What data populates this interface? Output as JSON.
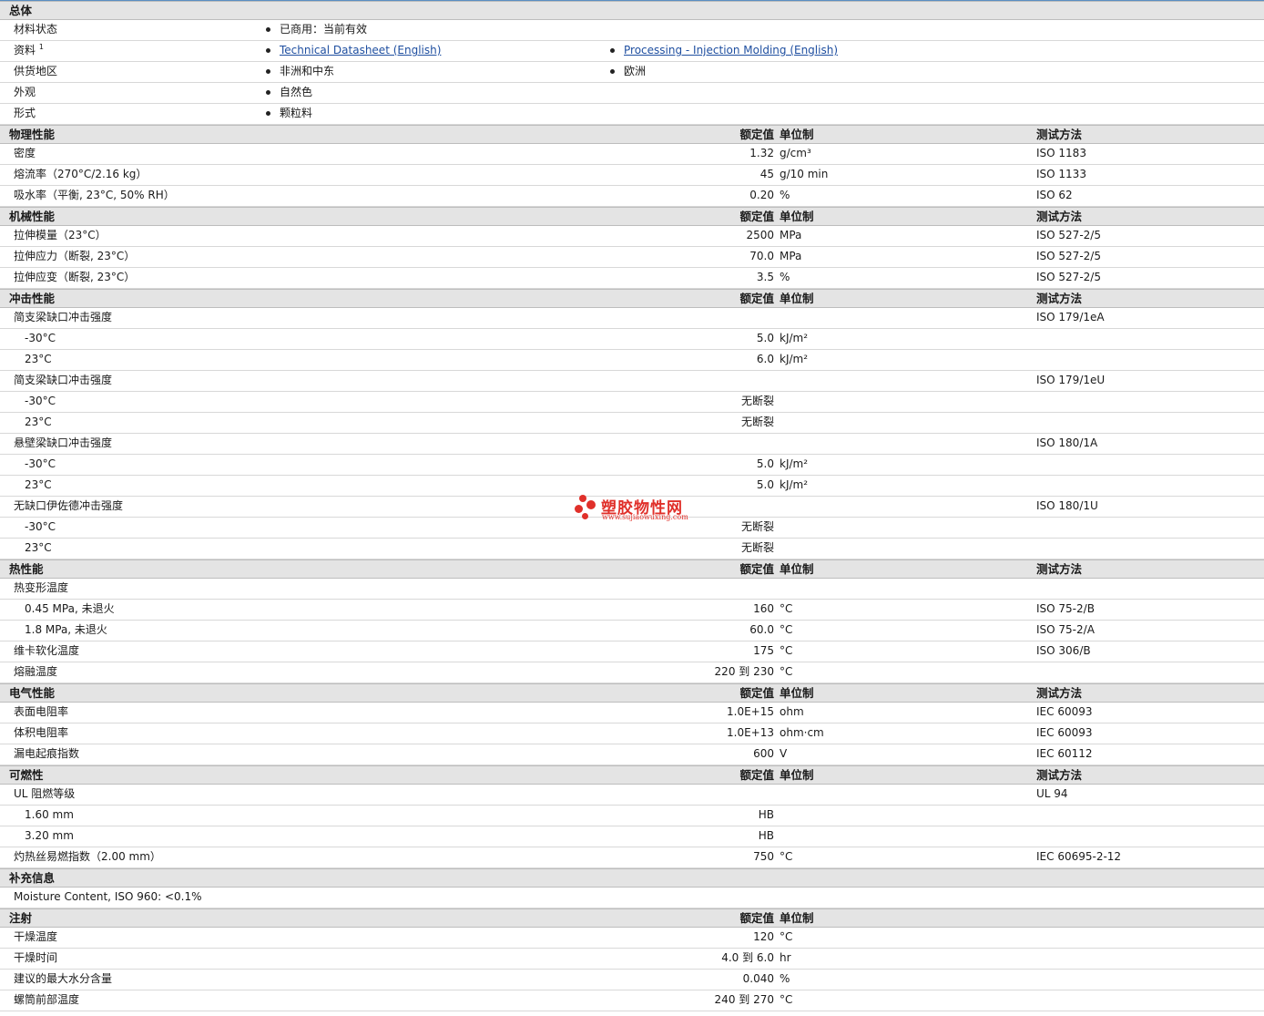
{
  "headers": {
    "value": "额定值",
    "unit": "单位制",
    "method": "测试方法"
  },
  "sections": [
    {
      "title": "总体",
      "show_headers": false,
      "rows": [
        {
          "kind": "bullets",
          "label": "材料状态",
          "items": [
            {
              "text": "已商用：当前有效",
              "link": false
            }
          ]
        },
        {
          "kind": "bullets",
          "label": "资料",
          "sup": "1",
          "items": [
            {
              "text": "Technical Datasheet (English)",
              "link": true
            },
            {
              "text": "Processing - Injection Molding (English)",
              "link": true
            }
          ]
        },
        {
          "kind": "bullets",
          "label": "供货地区",
          "items": [
            {
              "text": "非洲和中东",
              "link": false
            },
            {
              "text": "欧洲",
              "link": false
            }
          ]
        },
        {
          "kind": "bullets",
          "label": "外观",
          "items": [
            {
              "text": "自然色",
              "link": false
            }
          ]
        },
        {
          "kind": "bullets",
          "label": "形式",
          "items": [
            {
              "text": "颗粒料",
              "link": false
            }
          ]
        }
      ]
    },
    {
      "title": "物理性能",
      "show_headers": true,
      "rows": [
        {
          "label": "密度",
          "value": "1.32",
          "unit": "g/cm³",
          "method": "ISO 1183"
        },
        {
          "label": "熔流率（270°C/2.16 kg）",
          "value": "45",
          "unit": "g/10 min",
          "method": "ISO 1133"
        },
        {
          "label": "吸水率（平衡, 23°C, 50% RH）",
          "value": "0.20",
          "unit": "%",
          "method": "ISO 62"
        }
      ]
    },
    {
      "title": "机械性能",
      "show_headers": true,
      "rows": [
        {
          "label": "拉伸模量（23°C）",
          "value": "2500",
          "unit": "MPa",
          "method": "ISO 527-2/5"
        },
        {
          "label": "拉伸应力（断裂, 23°C）",
          "value": "70.0",
          "unit": "MPa",
          "method": "ISO 527-2/5"
        },
        {
          "label": "拉伸应变（断裂, 23°C）",
          "value": "3.5",
          "unit": "%",
          "method": "ISO 527-2/5"
        }
      ]
    },
    {
      "title": "冲击性能",
      "show_headers": true,
      "rows": [
        {
          "label": "简支梁缺口冲击强度",
          "value": "",
          "unit": "",
          "method": "ISO 179/1eA"
        },
        {
          "label": "-30°C",
          "sub": true,
          "value": "5.0",
          "unit": "kJ/m²",
          "method": ""
        },
        {
          "label": "23°C",
          "sub": true,
          "value": "6.0",
          "unit": "kJ/m²",
          "method": ""
        },
        {
          "label": "简支梁缺口冲击强度",
          "value": "",
          "unit": "",
          "method": "ISO 179/1eU"
        },
        {
          "label": "-30°C",
          "sub": true,
          "value_text": "无断裂",
          "unit": "",
          "method": ""
        },
        {
          "label": "23°C",
          "sub": true,
          "value_text": "无断裂",
          "unit": "",
          "method": ""
        },
        {
          "label": "悬壁梁缺口冲击强度",
          "value": "",
          "unit": "",
          "method": "ISO 180/1A"
        },
        {
          "label": "-30°C",
          "sub": true,
          "value": "5.0",
          "unit": "kJ/m²",
          "method": ""
        },
        {
          "label": "23°C",
          "sub": true,
          "value": "5.0",
          "unit": "kJ/m²",
          "method": ""
        },
        {
          "label": "无缺口伊佐德冲击强度",
          "value": "",
          "unit": "",
          "method": "ISO 180/1U"
        },
        {
          "label": "-30°C",
          "sub": true,
          "value_text": "无断裂",
          "unit": "",
          "method": ""
        },
        {
          "label": "23°C",
          "sub": true,
          "value_text": "无断裂",
          "unit": "",
          "method": ""
        }
      ]
    },
    {
      "title": "热性能",
      "show_headers": true,
      "rows": [
        {
          "label": "热变形温度",
          "value": "",
          "unit": "",
          "method": ""
        },
        {
          "label": "0.45 MPa, 未退火",
          "sub": true,
          "value": "160",
          "unit": "°C",
          "method": "ISO 75-2/B"
        },
        {
          "label": "1.8 MPa, 未退火",
          "sub": true,
          "value": "60.0",
          "unit": "°C",
          "method": "ISO 75-2/A"
        },
        {
          "label": "维卡软化温度",
          "value": "175",
          "unit": "°C",
          "method": "ISO 306/B"
        },
        {
          "label": "熔融温度",
          "value": "220 到  230",
          "unit": "°C",
          "method": ""
        }
      ]
    },
    {
      "title": "电气性能",
      "show_headers": true,
      "rows": [
        {
          "label": "表面电阻率",
          "value": "1.0E+15",
          "unit": "ohm",
          "method": "IEC 60093"
        },
        {
          "label": "体积电阻率",
          "value": "1.0E+13",
          "unit": "ohm·cm",
          "method": "IEC 60093"
        },
        {
          "label": "漏电起痕指数",
          "value": "600",
          "unit": "V",
          "method": "IEC 60112"
        }
      ]
    },
    {
      "title": "可燃性",
      "show_headers": true,
      "rows": [
        {
          "label": "UL 阻燃等级",
          "value": "",
          "unit": "",
          "method": "UL 94"
        },
        {
          "label": "1.60 mm",
          "sub": true,
          "value": "HB",
          "unit": "",
          "method": ""
        },
        {
          "label": "3.20 mm",
          "sub": true,
          "value": "HB",
          "unit": "",
          "method": ""
        },
        {
          "label": "灼热丝易燃指数（2.00 mm）",
          "value": "750",
          "unit": "°C",
          "method": "IEC 60695-2-12"
        }
      ]
    },
    {
      "title": "补充信息",
      "show_headers": false,
      "rows": [
        {
          "kind": "note",
          "label": "Moisture Content, ISO 960: <0.1%"
        }
      ]
    },
    {
      "title": "注射",
      "show_headers": true,
      "show_method_header": false,
      "rows": [
        {
          "label": "干燥温度",
          "value": "120",
          "unit": "°C",
          "method": ""
        },
        {
          "label": "干燥时间",
          "value": "4.0 到  6.0",
          "unit": "hr",
          "method": ""
        },
        {
          "label": "建议的最大水分含量",
          "value": "0.040",
          "unit": "%",
          "method": ""
        },
        {
          "label": "螺筒前部温度",
          "value": "240 到  270",
          "unit": "°C",
          "method": ""
        }
      ]
    }
  ],
  "watermark": {
    "name": "塑胶物性网",
    "url": "www.sujiaowuxing.com",
    "color": "#e0302a"
  }
}
